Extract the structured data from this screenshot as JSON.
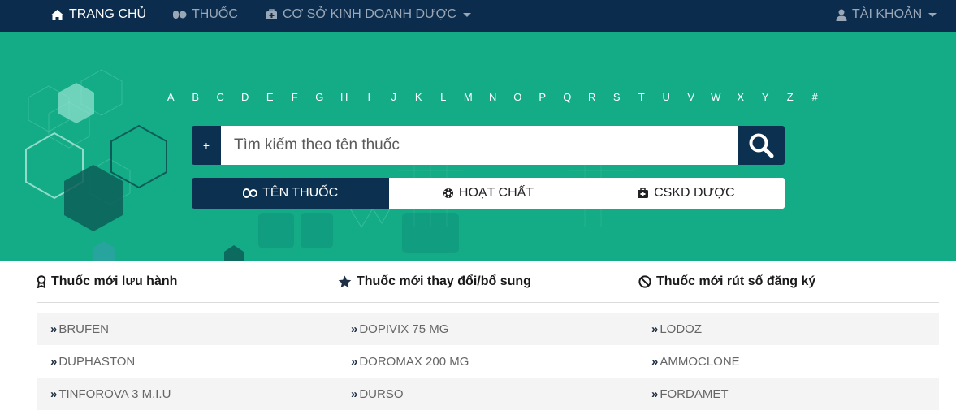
{
  "nav": {
    "home": "TRANG CHỦ",
    "drugs": "THUỐC",
    "pharma_business": "CƠ SỞ KINH DOANH DƯỢC",
    "account": "TÀI KHOẢN"
  },
  "alphabet": [
    "A",
    "B",
    "C",
    "D",
    "E",
    "F",
    "G",
    "H",
    "I",
    "J",
    "K",
    "L",
    "M",
    "N",
    "O",
    "P",
    "Q",
    "R",
    "S",
    "T",
    "U",
    "V",
    "W",
    "X",
    "Y",
    "Z",
    "#"
  ],
  "search": {
    "plus_label": "+",
    "placeholder": "Tìm kiếm theo tên thuốc"
  },
  "tabs": [
    {
      "label": "TÊN THUỐC",
      "icon": "pills-icon"
    },
    {
      "label": "HOẠT CHẤT",
      "icon": "atom-icon"
    },
    {
      "label": "CSKD DƯỢC",
      "icon": "medkit-icon"
    }
  ],
  "columns": {
    "new_drugs": {
      "title": "Thuốc mới lưu hành",
      "icon": "award-icon",
      "items": [
        "BRUFEN",
        "DUPHASTON",
        "TINFOROVA 3 M.I.U"
      ]
    },
    "changed_drugs": {
      "title": "Thuốc mới thay đổi/bổ sung",
      "icon": "star-icon",
      "items": [
        "DOPIVIX 75 MG",
        "DOROMAX 200 MG",
        "DURSO"
      ]
    },
    "withdrawn_drugs": {
      "title": "Thuốc mới rút số đăng ký",
      "icon": "ban-icon",
      "items": [
        "LODOZ",
        "AMMOCLONE",
        "FORDAMET"
      ]
    }
  },
  "colors": {
    "navbar": "#0b2c4d",
    "hero": "#13ac86",
    "accent": "#0c3150"
  }
}
